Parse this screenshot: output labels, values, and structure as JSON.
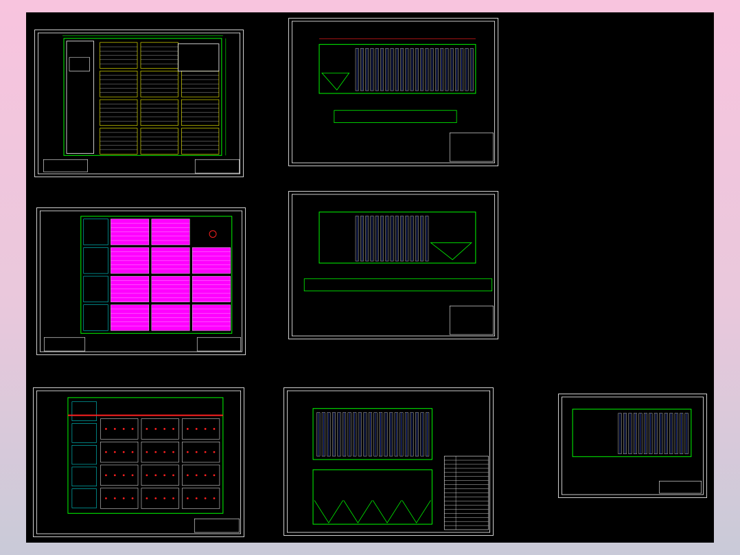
{
  "colors": {
    "background": "#000000",
    "page_gradient_top": "#f8c4de",
    "page_gradient_bottom": "#c9cad8",
    "frame": "#d0d0d0",
    "line_green": "#00ff00",
    "line_cyan": "#00ffff",
    "line_white": "#ffffff",
    "fill_yellow": "#ffff00",
    "fill_magenta": "#ff00ff",
    "pipe_red": "#ff2020",
    "line_blue": "#4060ff"
  },
  "sheets": [
    {
      "id": "plan-yellow",
      "kind": "plan",
      "accent": "#ffff00"
    },
    {
      "id": "section-a",
      "kind": "section"
    },
    {
      "id": "plan-magenta",
      "kind": "plan",
      "accent": "#ff00ff"
    },
    {
      "id": "section-b",
      "kind": "section"
    },
    {
      "id": "plan-piping",
      "kind": "plan-pipe",
      "accent": "#ff2020"
    },
    {
      "id": "section-c",
      "kind": "section-hopper"
    },
    {
      "id": "section-d",
      "kind": "section-small"
    }
  ]
}
